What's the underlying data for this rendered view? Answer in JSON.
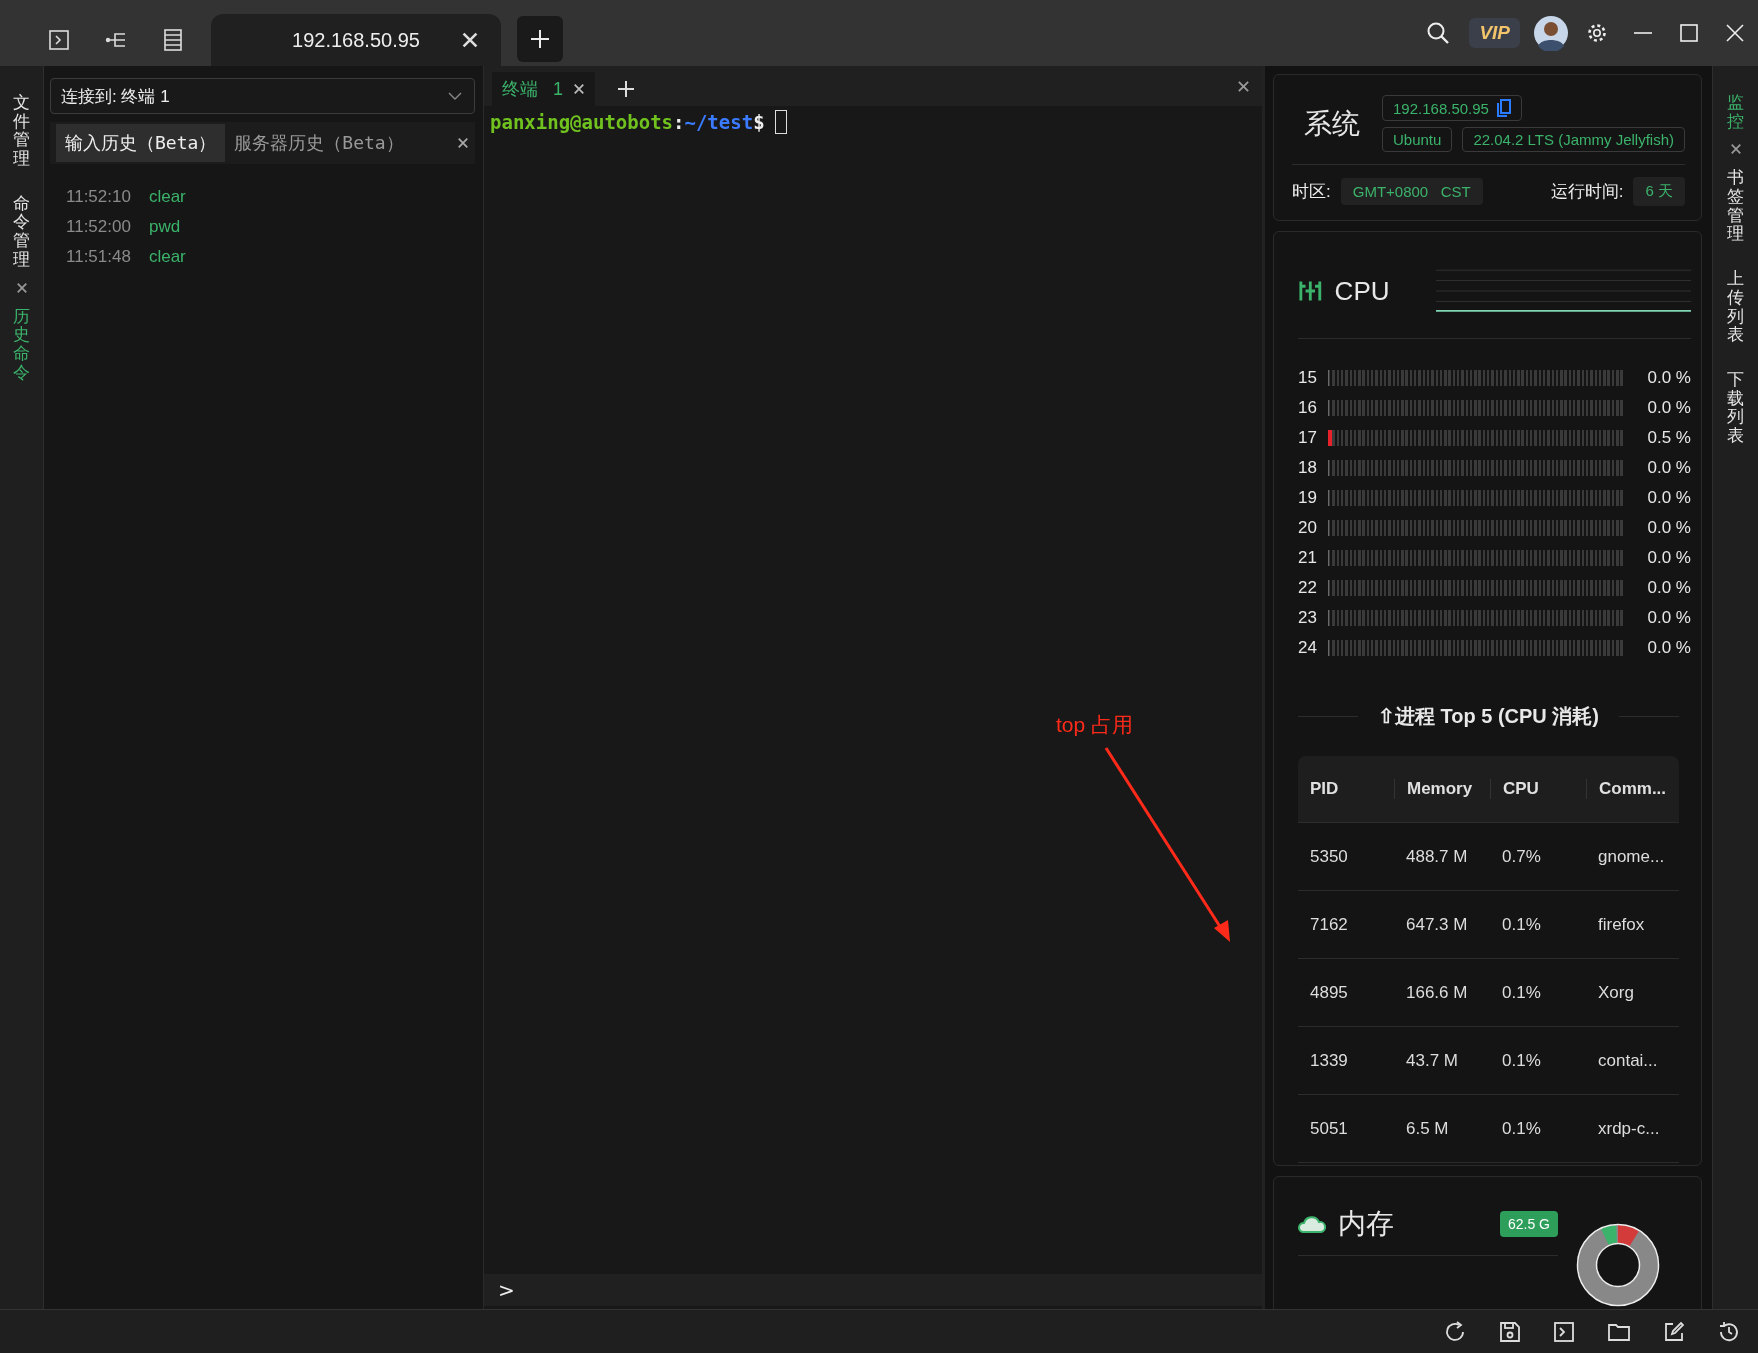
{
  "session_tab": {
    "label": "192.168.50.95",
    "selected": true
  },
  "vip_badge": "VIP",
  "left_sidebar": [
    {
      "label": "文件管理",
      "selected": false
    },
    {
      "label": "命令管理",
      "selected": false
    },
    {
      "label": "历史命令",
      "selected": true
    }
  ],
  "connection": {
    "value": "连接到: 终端 1"
  },
  "history_tabs": [
    {
      "label": "输入历史（Beta）",
      "selected": true
    },
    {
      "label": "服务器历史（Beta）",
      "selected": false
    }
  ],
  "history": [
    {
      "time": "11:52:10",
      "command": "clear"
    },
    {
      "time": "11:52:00",
      "command": "pwd"
    },
    {
      "time": "11:51:48",
      "command": "clear"
    }
  ],
  "terminal": {
    "tabs": [
      {
        "label": "终端",
        "number": "1",
        "selected": true
      }
    ],
    "prompt_user": "panxing@autobots",
    "prompt_separator": ":",
    "prompt_path": "~/test",
    "prompt_symbol": "$",
    "input_prompt": ">"
  },
  "annotation": {
    "text": "top 占用"
  },
  "system": {
    "title": "系统",
    "ip": "192.168.50.95",
    "os": "Ubuntu",
    "version": "22.04.2 LTS (Jammy Jellyfish)",
    "timezone_label": "时区:",
    "timezone": "GMT+0800   CST",
    "uptime_label": "运行时间:",
    "uptime": "6 天"
  },
  "cpu": {
    "title": "CPU",
    "cores": [
      {
        "name": "15",
        "level": 0,
        "reading": "0.0 %"
      },
      {
        "name": "16",
        "level": 0,
        "reading": "0.0 %"
      },
      {
        "name": "17",
        "level": 0.005,
        "reading": "0.5 %"
      },
      {
        "name": "18",
        "level": 0,
        "reading": "0.0 %"
      },
      {
        "name": "19",
        "level": 0,
        "reading": "0.0 %"
      },
      {
        "name": "20",
        "level": 0,
        "reading": "0.0 %"
      },
      {
        "name": "21",
        "level": 0,
        "reading": "0.0 %"
      },
      {
        "name": "22",
        "level": 0,
        "reading": "0.0 %"
      },
      {
        "name": "23",
        "level": 0,
        "reading": "0.0 %"
      },
      {
        "name": "24",
        "level": 0,
        "reading": "0.0 %"
      }
    ]
  },
  "processes": {
    "title": "⇧进程 Top 5 (CPU 消耗)",
    "columns": [
      "PID",
      "Memory",
      "CPU",
      "Comm..."
    ],
    "rows": [
      [
        "5350",
        "488.7 M",
        "0.7%",
        "gnome..."
      ],
      [
        "7162",
        "647.3 M",
        "0.1%",
        "firefox"
      ],
      [
        "4895",
        "166.6 M",
        "0.1%",
        "Xorg"
      ],
      [
        "1339",
        "43.7 M",
        "0.1%",
        "contai..."
      ],
      [
        "5051",
        "6.5 M",
        "0.1%",
        "xrdp-c..."
      ]
    ]
  },
  "memory": {
    "title": "内存",
    "total": "62.5 G"
  },
  "right_sidebar": [
    {
      "label": "监控",
      "selected": true
    },
    {
      "label": "书签管理",
      "selected": false
    },
    {
      "label": "上传列表",
      "selected": false
    },
    {
      "label": "下载列表",
      "selected": false
    }
  ]
}
